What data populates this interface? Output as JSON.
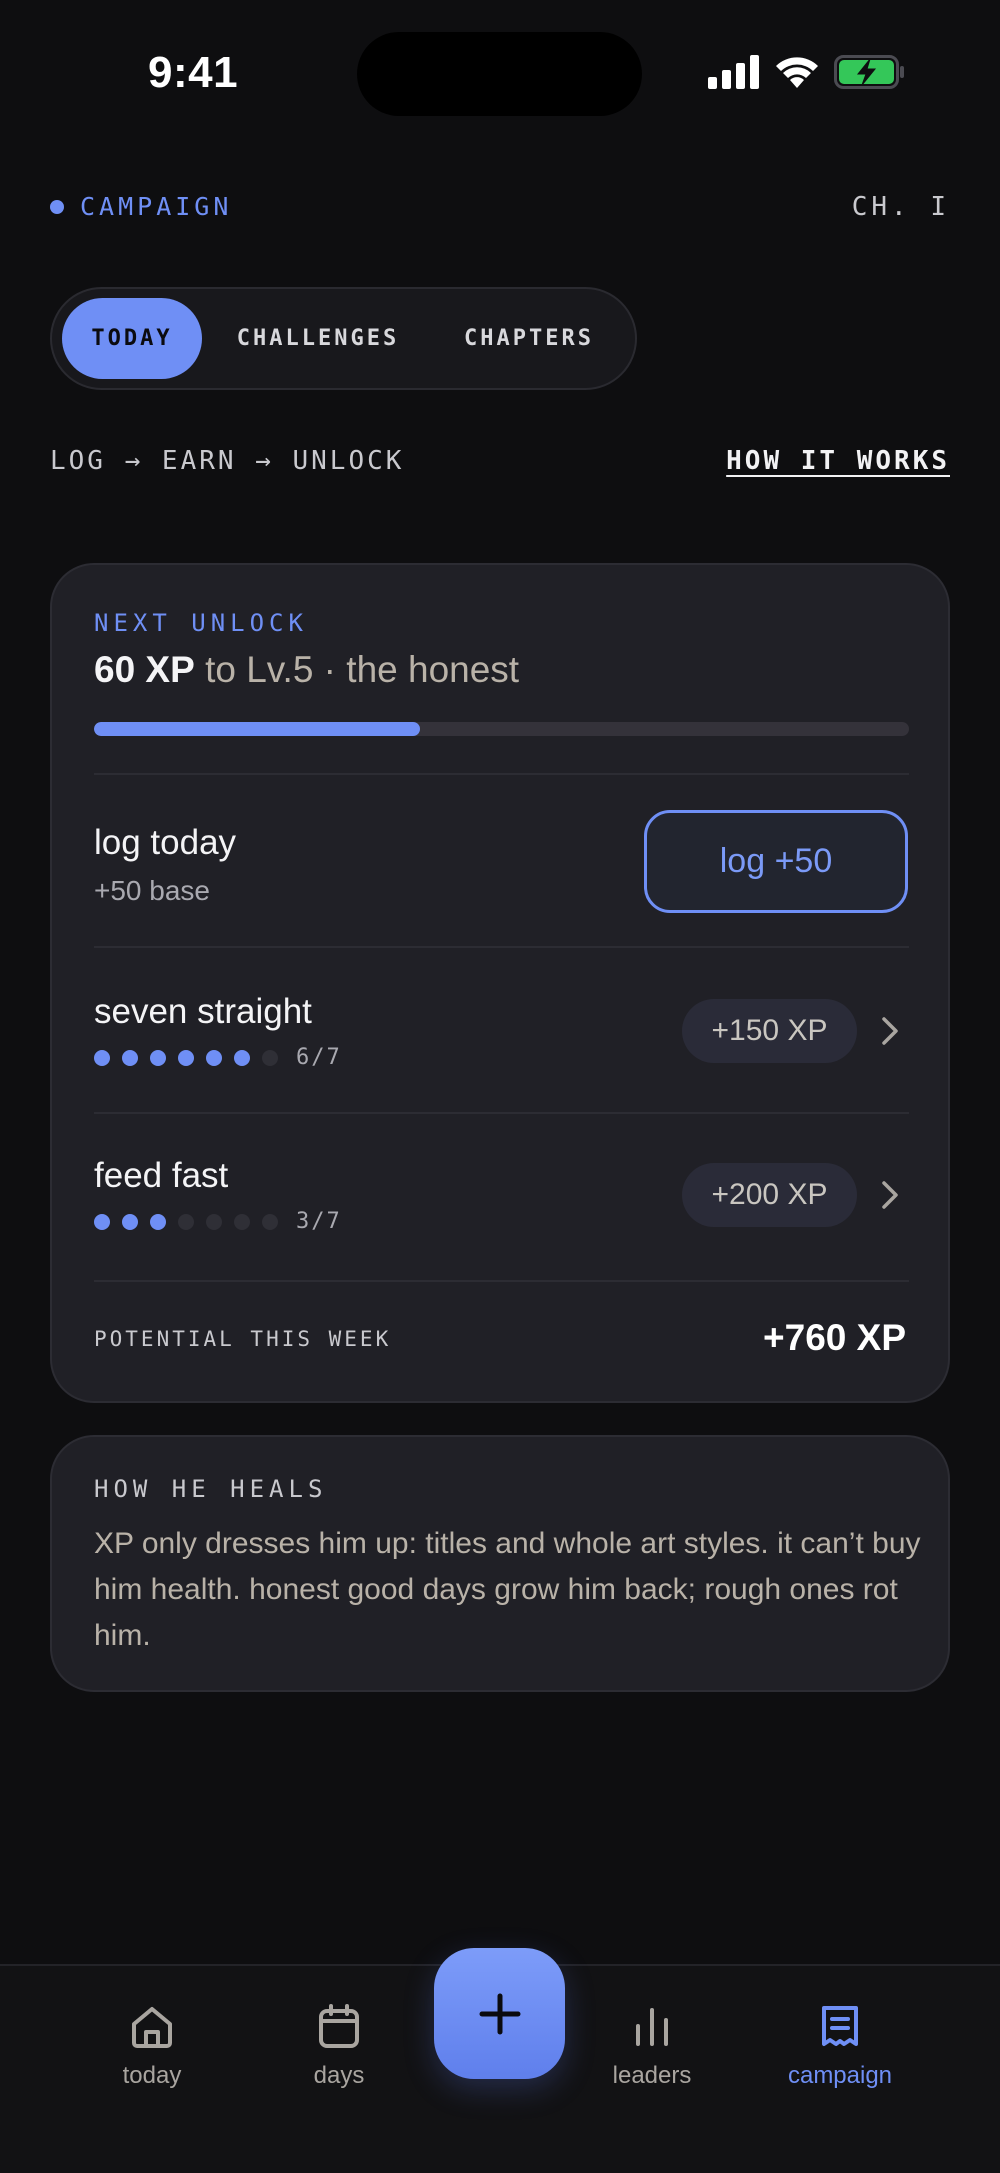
{
  "status_bar": {
    "time": "9:41"
  },
  "header": {
    "section": "CAMPAIGN",
    "chapter": "CH. I"
  },
  "tabs": [
    {
      "label": "TODAY",
      "active": true
    },
    {
      "label": "CHALLENGES",
      "active": false
    },
    {
      "label": "CHAPTERS",
      "active": false
    }
  ],
  "flow": {
    "text": "LOG → EARN → UNLOCK",
    "link": "HOW IT WORKS"
  },
  "next_unlock": {
    "label": "NEXT UNLOCK",
    "xp": "60 XP",
    "rest": " to Lv.5 · the honest",
    "progress": 0.4
  },
  "log_today": {
    "title": "log today",
    "sub": "+50 base",
    "button": "log +50"
  },
  "challenges": [
    {
      "title": "seven straight",
      "done": 6,
      "total": 7,
      "count": "6/7",
      "reward": "+150 XP"
    },
    {
      "title": "feed fast",
      "done": 3,
      "total": 7,
      "count": "3/7",
      "reward": "+200 XP"
    }
  ],
  "potential": {
    "label": "POTENTIAL THIS WEEK",
    "value": "+760 XP"
  },
  "heal": {
    "label": "HOW HE HEALS",
    "text": "XP only dresses him up: titles and whole art styles. it can’t buy him health. honest good days grow him back; rough ones rot him."
  },
  "nav": [
    {
      "label": "today",
      "icon": "home-icon",
      "active": false
    },
    {
      "label": "days",
      "icon": "calendar-icon",
      "active": false
    },
    {
      "label": "leaders",
      "icon": "bar-chart-icon",
      "active": false
    },
    {
      "label": "campaign",
      "icon": "campaign-doc-icon",
      "active": true
    }
  ],
  "colors": {
    "accent": "#6f8ff5",
    "background": "#0e0e10",
    "card": "#202026",
    "battery": "#34c759"
  }
}
